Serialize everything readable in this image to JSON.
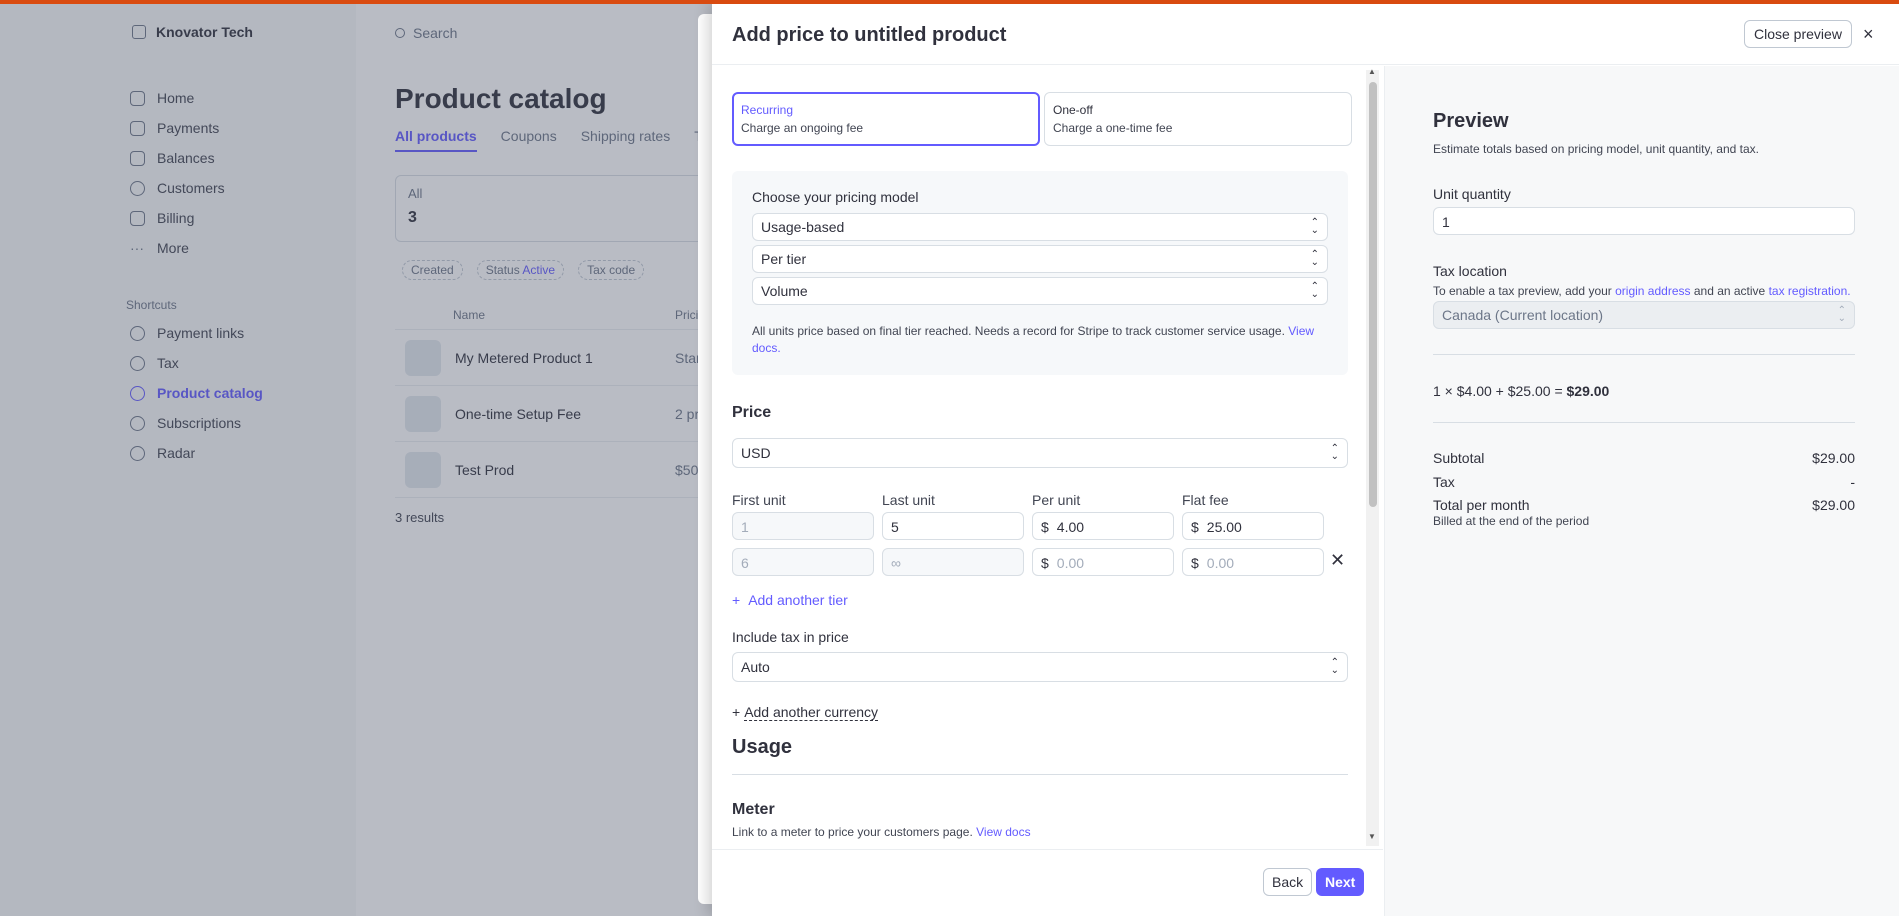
{
  "background": {
    "brand": "Knovator Tech",
    "nav": [
      "Home",
      "Payments",
      "Balances",
      "Customers",
      "Billing",
      "More"
    ],
    "shortcuts_label": "Shortcuts",
    "shortcuts": [
      "Payment links",
      "Tax",
      "Product catalog",
      "Subscriptions",
      "Radar"
    ],
    "search_placeholder": "Search",
    "page_title": "Product catalog",
    "tabs": [
      "All products",
      "Coupons",
      "Shipping rates",
      "T"
    ],
    "card": {
      "label": "All",
      "count": "3"
    },
    "filters": [
      "Created",
      "Status",
      "Active",
      "Tax code"
    ],
    "table_headers": [
      "Name",
      "Prici"
    ],
    "rows": [
      {
        "name": "My Metered Product 1",
        "price": "Star"
      },
      {
        "name": "One-time Setup Fee",
        "price": "2 pr"
      },
      {
        "name": "Test Prod",
        "price": "$50."
      }
    ],
    "results": "3 results"
  },
  "modal": {
    "title": "Add price to untitled product",
    "close_preview": "Close preview",
    "close_icon": "×",
    "billing_options": [
      {
        "title": "Recurring",
        "desc": "Charge an ongoing fee",
        "selected": true
      },
      {
        "title": "One-off",
        "desc": "Charge a one-time fee",
        "selected": false
      }
    ],
    "pricing_model_label": "Choose your pricing model",
    "pricing_model": "Usage-based",
    "tier_mode": "Per tier",
    "tier_type": "Volume",
    "help_text": "All units price based on final tier reached. Needs a record for Stripe to track customer service usage.",
    "view_docs": "View docs.",
    "price_label": "Price",
    "currency": "USD",
    "columns": [
      "First unit",
      "Last unit",
      "Per unit",
      "Flat fee"
    ],
    "currency_symbol": "$",
    "tiers": [
      {
        "first": "1",
        "last": "5",
        "per_unit": "4.00",
        "flat_fee": "25.00"
      },
      {
        "first": "6",
        "last": "∞",
        "per_unit": "0.00",
        "flat_fee": "0.00"
      }
    ],
    "add_tier": "Add another tier",
    "include_tax_label": "Include tax in price",
    "include_tax": "Auto",
    "add_currency": "Add another currency",
    "usage_title": "Usage",
    "meter_title": "Meter",
    "meter_desc": "Link to a meter to price your customers page.",
    "meter_link": "View docs",
    "back": "Back",
    "next": "Next"
  },
  "preview": {
    "title": "Preview",
    "subtitle": "Estimate totals based on pricing model, unit quantity, and tax.",
    "unit_quantity_label": "Unit quantity",
    "unit_quantity": "1",
    "tax_location_label": "Tax location",
    "tax_note_a": "To enable a tax preview, add your",
    "tax_note_link1": "origin address",
    "tax_note_b": "and an active",
    "tax_note_link2": "tax registration.",
    "tax_location": "Canada (Current location)",
    "calc": "1 × $4.00 + $25.00 =",
    "calc_total": "$29.00",
    "subtotal_label": "Subtotal",
    "subtotal": "$29.00",
    "tax_label": "Tax",
    "tax": "-",
    "total_label": "Total per month",
    "total": "$29.00",
    "billed": "Billed at the end of the period"
  },
  "colors": {
    "accent": "#635bff",
    "topbar": "#d94b10"
  }
}
